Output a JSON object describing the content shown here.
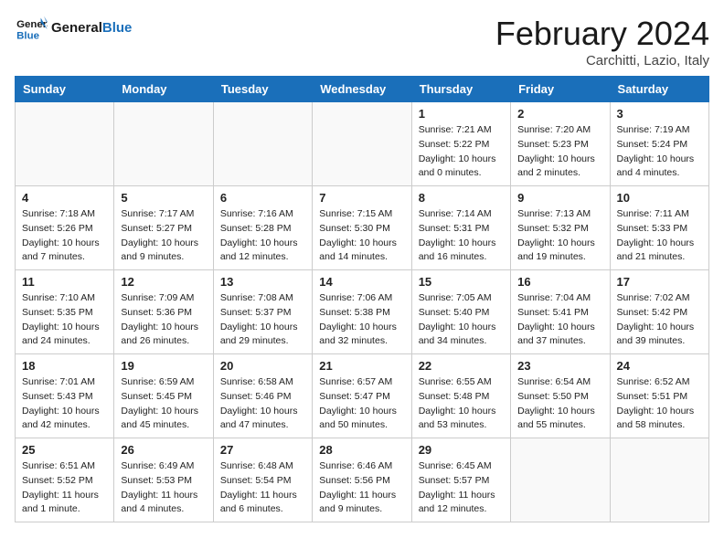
{
  "header": {
    "logo_line1": "General",
    "logo_line2": "Blue",
    "month_title": "February 2024",
    "location": "Carchitti, Lazio, Italy"
  },
  "weekdays": [
    "Sunday",
    "Monday",
    "Tuesday",
    "Wednesday",
    "Thursday",
    "Friday",
    "Saturday"
  ],
  "weeks": [
    [
      {
        "day": "",
        "detail": ""
      },
      {
        "day": "",
        "detail": ""
      },
      {
        "day": "",
        "detail": ""
      },
      {
        "day": "",
        "detail": ""
      },
      {
        "day": "1",
        "detail": "Sunrise: 7:21 AM\nSunset: 5:22 PM\nDaylight: 10 hours\nand 0 minutes."
      },
      {
        "day": "2",
        "detail": "Sunrise: 7:20 AM\nSunset: 5:23 PM\nDaylight: 10 hours\nand 2 minutes."
      },
      {
        "day": "3",
        "detail": "Sunrise: 7:19 AM\nSunset: 5:24 PM\nDaylight: 10 hours\nand 4 minutes."
      }
    ],
    [
      {
        "day": "4",
        "detail": "Sunrise: 7:18 AM\nSunset: 5:26 PM\nDaylight: 10 hours\nand 7 minutes."
      },
      {
        "day": "5",
        "detail": "Sunrise: 7:17 AM\nSunset: 5:27 PM\nDaylight: 10 hours\nand 9 minutes."
      },
      {
        "day": "6",
        "detail": "Sunrise: 7:16 AM\nSunset: 5:28 PM\nDaylight: 10 hours\nand 12 minutes."
      },
      {
        "day": "7",
        "detail": "Sunrise: 7:15 AM\nSunset: 5:30 PM\nDaylight: 10 hours\nand 14 minutes."
      },
      {
        "day": "8",
        "detail": "Sunrise: 7:14 AM\nSunset: 5:31 PM\nDaylight: 10 hours\nand 16 minutes."
      },
      {
        "day": "9",
        "detail": "Sunrise: 7:13 AM\nSunset: 5:32 PM\nDaylight: 10 hours\nand 19 minutes."
      },
      {
        "day": "10",
        "detail": "Sunrise: 7:11 AM\nSunset: 5:33 PM\nDaylight: 10 hours\nand 21 minutes."
      }
    ],
    [
      {
        "day": "11",
        "detail": "Sunrise: 7:10 AM\nSunset: 5:35 PM\nDaylight: 10 hours\nand 24 minutes."
      },
      {
        "day": "12",
        "detail": "Sunrise: 7:09 AM\nSunset: 5:36 PM\nDaylight: 10 hours\nand 26 minutes."
      },
      {
        "day": "13",
        "detail": "Sunrise: 7:08 AM\nSunset: 5:37 PM\nDaylight: 10 hours\nand 29 minutes."
      },
      {
        "day": "14",
        "detail": "Sunrise: 7:06 AM\nSunset: 5:38 PM\nDaylight: 10 hours\nand 32 minutes."
      },
      {
        "day": "15",
        "detail": "Sunrise: 7:05 AM\nSunset: 5:40 PM\nDaylight: 10 hours\nand 34 minutes."
      },
      {
        "day": "16",
        "detail": "Sunrise: 7:04 AM\nSunset: 5:41 PM\nDaylight: 10 hours\nand 37 minutes."
      },
      {
        "day": "17",
        "detail": "Sunrise: 7:02 AM\nSunset: 5:42 PM\nDaylight: 10 hours\nand 39 minutes."
      }
    ],
    [
      {
        "day": "18",
        "detail": "Sunrise: 7:01 AM\nSunset: 5:43 PM\nDaylight: 10 hours\nand 42 minutes."
      },
      {
        "day": "19",
        "detail": "Sunrise: 6:59 AM\nSunset: 5:45 PM\nDaylight: 10 hours\nand 45 minutes."
      },
      {
        "day": "20",
        "detail": "Sunrise: 6:58 AM\nSunset: 5:46 PM\nDaylight: 10 hours\nand 47 minutes."
      },
      {
        "day": "21",
        "detail": "Sunrise: 6:57 AM\nSunset: 5:47 PM\nDaylight: 10 hours\nand 50 minutes."
      },
      {
        "day": "22",
        "detail": "Sunrise: 6:55 AM\nSunset: 5:48 PM\nDaylight: 10 hours\nand 53 minutes."
      },
      {
        "day": "23",
        "detail": "Sunrise: 6:54 AM\nSunset: 5:50 PM\nDaylight: 10 hours\nand 55 minutes."
      },
      {
        "day": "24",
        "detail": "Sunrise: 6:52 AM\nSunset: 5:51 PM\nDaylight: 10 hours\nand 58 minutes."
      }
    ],
    [
      {
        "day": "25",
        "detail": "Sunrise: 6:51 AM\nSunset: 5:52 PM\nDaylight: 11 hours\nand 1 minute."
      },
      {
        "day": "26",
        "detail": "Sunrise: 6:49 AM\nSunset: 5:53 PM\nDaylight: 11 hours\nand 4 minutes."
      },
      {
        "day": "27",
        "detail": "Sunrise: 6:48 AM\nSunset: 5:54 PM\nDaylight: 11 hours\nand 6 minutes."
      },
      {
        "day": "28",
        "detail": "Sunrise: 6:46 AM\nSunset: 5:56 PM\nDaylight: 11 hours\nand 9 minutes."
      },
      {
        "day": "29",
        "detail": "Sunrise: 6:45 AM\nSunset: 5:57 PM\nDaylight: 11 hours\nand 12 minutes."
      },
      {
        "day": "",
        "detail": ""
      },
      {
        "day": "",
        "detail": ""
      }
    ]
  ]
}
